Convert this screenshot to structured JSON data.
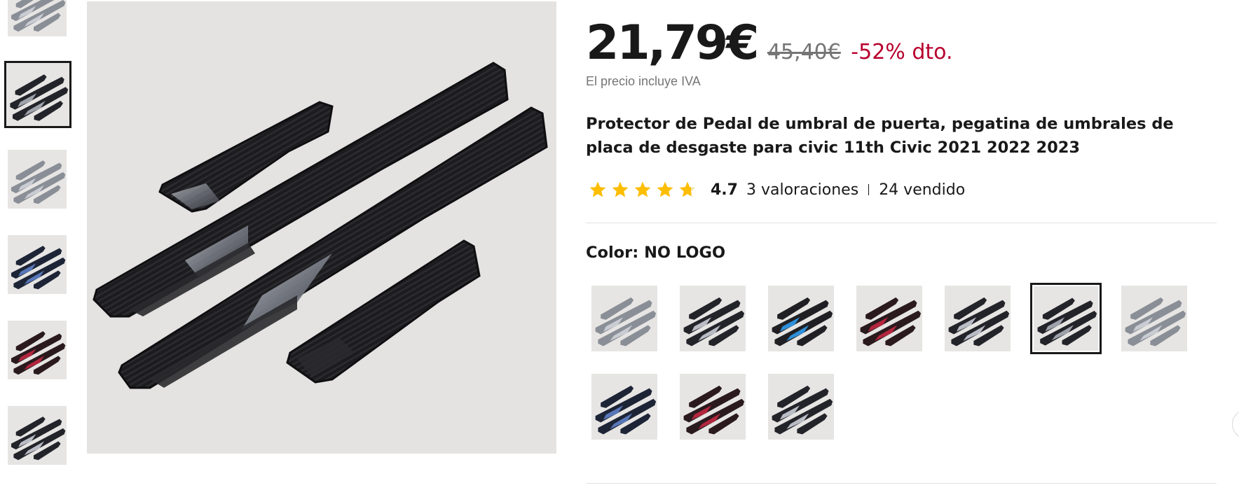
{
  "product": {
    "price": "21,79€",
    "original_price": "45,40€",
    "discount": "-52% dto.",
    "tax_note": "El precio incluye IVA",
    "title": "Protector de Pedal de umbral de puerta, pegatina de umbrales de placa de desgaste para civic 11th Civic 2021 2022 2023"
  },
  "rating": {
    "stars": 4.7,
    "value": "4.7",
    "reviews": "3 valoraciones",
    "sold": "24 vendido",
    "star_color": "#fdbd00"
  },
  "color_option": {
    "label": "Color: NO LOGO",
    "selected_index": 5,
    "swatches": [
      {
        "variant": "silver-carbon"
      },
      {
        "variant": "black-silver"
      },
      {
        "variant": "blue-led"
      },
      {
        "variant": "red"
      },
      {
        "variant": "black-silver-2"
      },
      {
        "variant": "no-logo"
      },
      {
        "variant": "silver-carbon-2"
      },
      {
        "variant": "blue"
      },
      {
        "variant": "red-2"
      },
      {
        "variant": "black-silver-3"
      }
    ]
  },
  "gallery": {
    "selected_index": 1,
    "thumbnails": [
      {
        "variant": "silver-carbon"
      },
      {
        "variant": "no-logo"
      },
      {
        "variant": "silver-carbon-2"
      },
      {
        "variant": "blue"
      },
      {
        "variant": "red"
      },
      {
        "variant": "black-silver"
      }
    ]
  },
  "colors": {
    "discount": "#b8002e",
    "muted_text": "#757575",
    "star": "#fdbd00",
    "selected_border": "#191919"
  }
}
